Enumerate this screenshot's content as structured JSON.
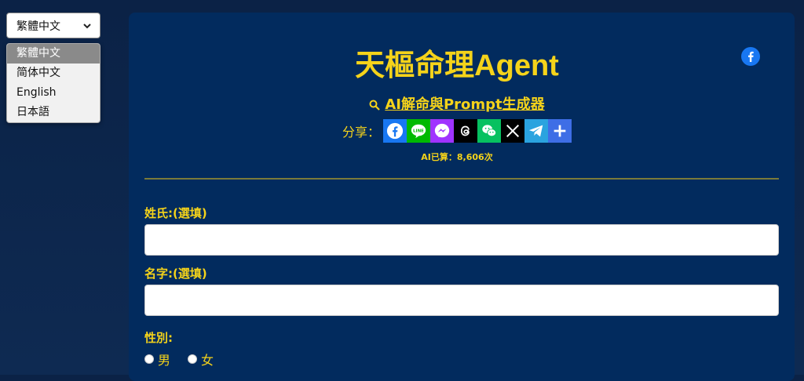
{
  "language": {
    "selected": "繁體中文",
    "options": [
      "繁體中文",
      "简体中文",
      "English",
      "日本語"
    ]
  },
  "header": {
    "title": "天樞命理Agent",
    "subtitle": "AI解命與Prompt生成器",
    "share_label": "分享：",
    "share_icons": [
      "facebook-icon",
      "line-icon",
      "messenger-icon",
      "threads-icon",
      "wechat-icon",
      "x-icon",
      "telegram-icon",
      "more-share-icon"
    ],
    "count_text": "AI已算：8,606次"
  },
  "form": {
    "surname_label": "姓氏:(選填)",
    "surname_value": "",
    "name_label": "名字:(選填)",
    "name_value": "",
    "gender_label": "性別:",
    "gender_options": [
      "男",
      "女"
    ]
  },
  "colors": {
    "accent": "#f5d31a",
    "card_bg": "#022b5e",
    "page_bg": "#0c2347"
  }
}
